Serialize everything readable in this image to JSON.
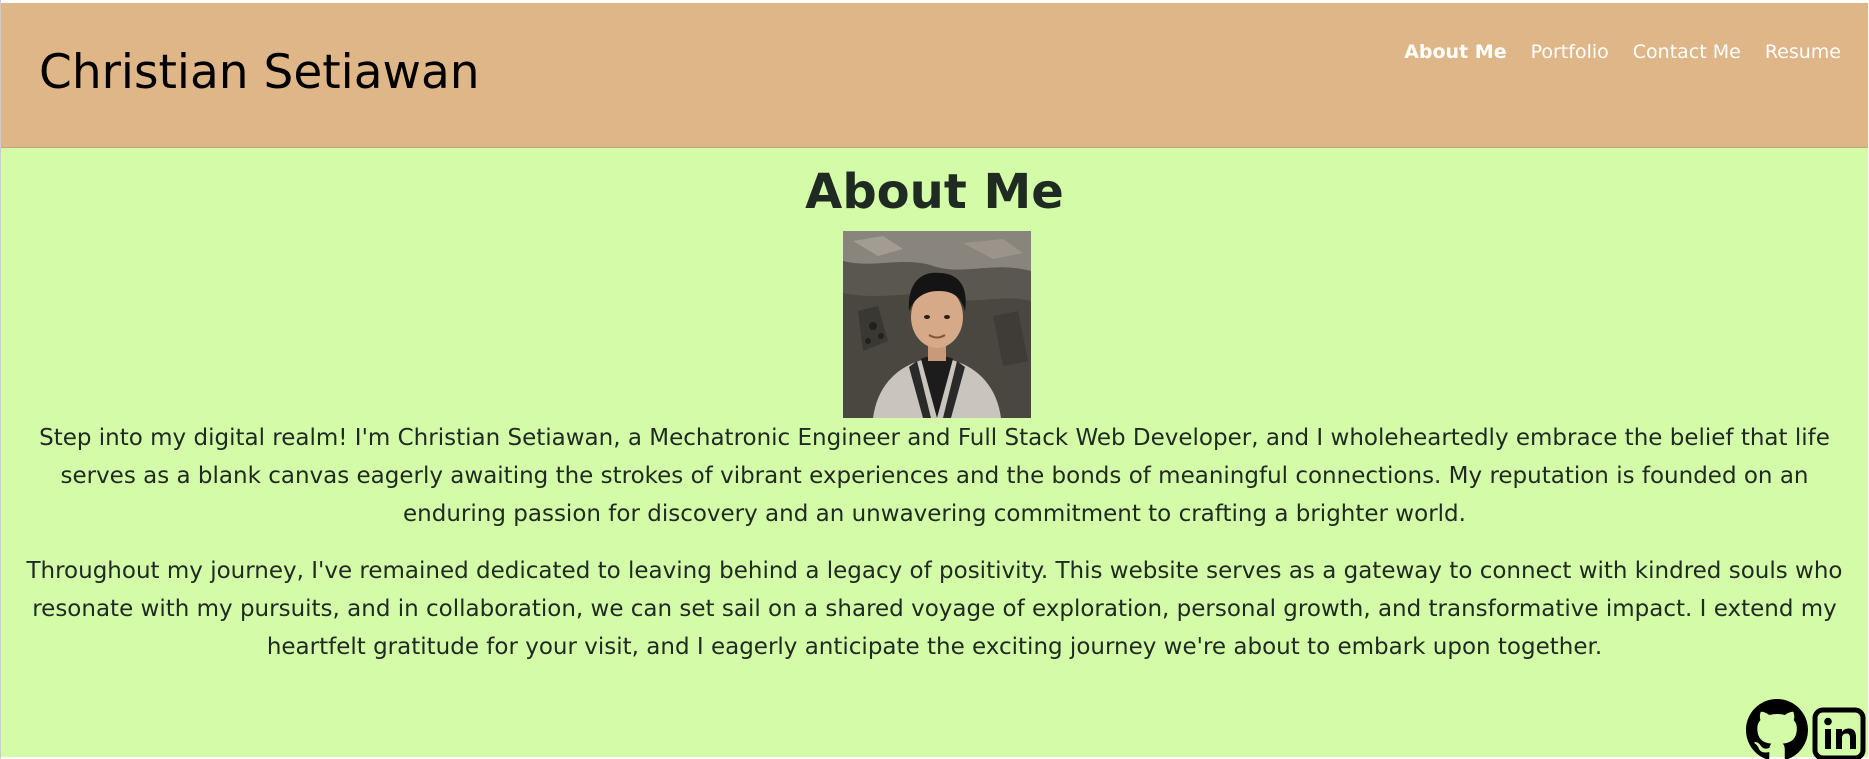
{
  "header": {
    "site_title": "Christian Setiawan",
    "nav": [
      {
        "label": "About Me",
        "active": true
      },
      {
        "label": "Portfolio",
        "active": false
      },
      {
        "label": "Contact Me",
        "active": false
      },
      {
        "label": "Resume",
        "active": false
      }
    ]
  },
  "main": {
    "title": "About Me",
    "portrait_icon": "portrait-photo",
    "paragraphs": [
      "Step into my digital realm! I'm Christian Setiawan, a Mechatronic Engineer and Full Stack Web Developer, and I wholeheartedly embrace the belief that life serves as a blank canvas eagerly awaiting the strokes of vibrant experiences and the bonds of meaningful connections. My reputation is founded on an enduring passion for discovery and an unwavering commitment to crafting a brighter world.",
      "Throughout my journey, I've remained dedicated to leaving behind a legacy of positivity. This website serves as a gateway to connect with kindred souls who resonate with my pursuits, and in collaboration, we can set sail on a shared voyage of exploration, personal growth, and transformative impact. I extend my heartfelt gratitude for your visit, and I eagerly anticipate the exciting journey we're about to embark upon together."
    ]
  },
  "social": {
    "icons": [
      "github-icon",
      "linkedin-icon"
    ]
  },
  "colors": {
    "header_bg": "#dfb687",
    "main_bg": "#d4fba8",
    "nav_text": "#ffffff",
    "body_text": "#1f2a22"
  }
}
